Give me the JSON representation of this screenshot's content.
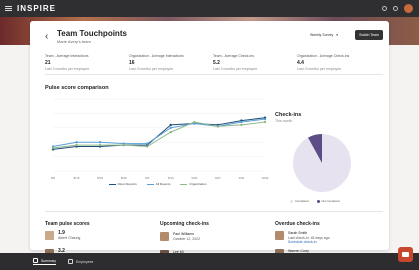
{
  "app": {
    "brand": "INSPIRE"
  },
  "page": {
    "title": "Team Touchpoints",
    "subtitle": "Marie Avery's team",
    "survey_select": "Weekly Survey",
    "switch_team": "Switch Team"
  },
  "metrics": [
    {
      "label": "Team - Average Interactions",
      "value": "21",
      "note": "Last 3 months per employee"
    },
    {
      "label": "Organization - Average Interactions",
      "value": "16",
      "note": "Last 3 months per employee"
    },
    {
      "label": "Team - Average Check-ins",
      "value": "5.2",
      "note": "Last 3 months per employee"
    },
    {
      "label": "Organization - Average Check-ins",
      "value": "4.4",
      "note": "Last 3 months per employee"
    }
  ],
  "pulse": {
    "title": "Pulse score comparison"
  },
  "checkins": {
    "title": "Check-ins",
    "subtitle": "This month"
  },
  "chart_data": {
    "type": "line",
    "title": "Pulse score comparison",
    "x": [
      "8/9",
      "8/16",
      "8/23",
      "8/30",
      "9/6",
      "9/13",
      "9/20",
      "9/27",
      "10/4",
      "10/11"
    ],
    "ylim": [
      0,
      5
    ],
    "series": [
      {
        "name": "Direct Reports",
        "color": "#1f4e79",
        "values": [
          1.5,
          1.7,
          1.7,
          1.8,
          1.8,
          3.2,
          3.3,
          3.2,
          3.5,
          3.7
        ]
      },
      {
        "name": "All Reports",
        "color": "#5aa0d6",
        "values": [
          1.7,
          2.0,
          2.0,
          1.9,
          1.9,
          3.0,
          3.3,
          3.1,
          3.4,
          3.6
        ]
      },
      {
        "name": "Organization",
        "color": "#8fb88a",
        "values": [
          1.6,
          1.8,
          1.8,
          1.8,
          1.7,
          2.7,
          3.4,
          3.1,
          3.2,
          3.4
        ]
      }
    ],
    "grid": true,
    "legend": "bottom"
  },
  "pie": {
    "slices": [
      {
        "name": "Completed",
        "value": 92,
        "color": "#e7e2ef"
      },
      {
        "name": "Not completed",
        "value": 8,
        "color": "#5b4c86"
      }
    ]
  },
  "sections": {
    "team_pulse": "Team pulse scores",
    "upcoming": "Upcoming check-ins",
    "overdue": "Overdue check-ins"
  },
  "team_pulse": [
    {
      "score": "1.9",
      "name": "Albert Cheung"
    },
    {
      "score": "3.2",
      "name": "Colin Ho"
    }
  ],
  "upcoming": [
    {
      "name": "Paul Williams",
      "date": "October 12, 2022"
    },
    {
      "name": "Lee Mi",
      "date": "October 13, 2022"
    }
  ],
  "overdue": [
    {
      "name": "Sarah Smith",
      "date": "Last check-in: 45 days ago",
      "link": "Schedule check-in"
    },
    {
      "name": "Warren Curry",
      "date": "Last check-in: 50 days ago",
      "link": "Schedule check-in"
    }
  ],
  "nav": {
    "summary": "Summary",
    "employees": "Employees"
  }
}
